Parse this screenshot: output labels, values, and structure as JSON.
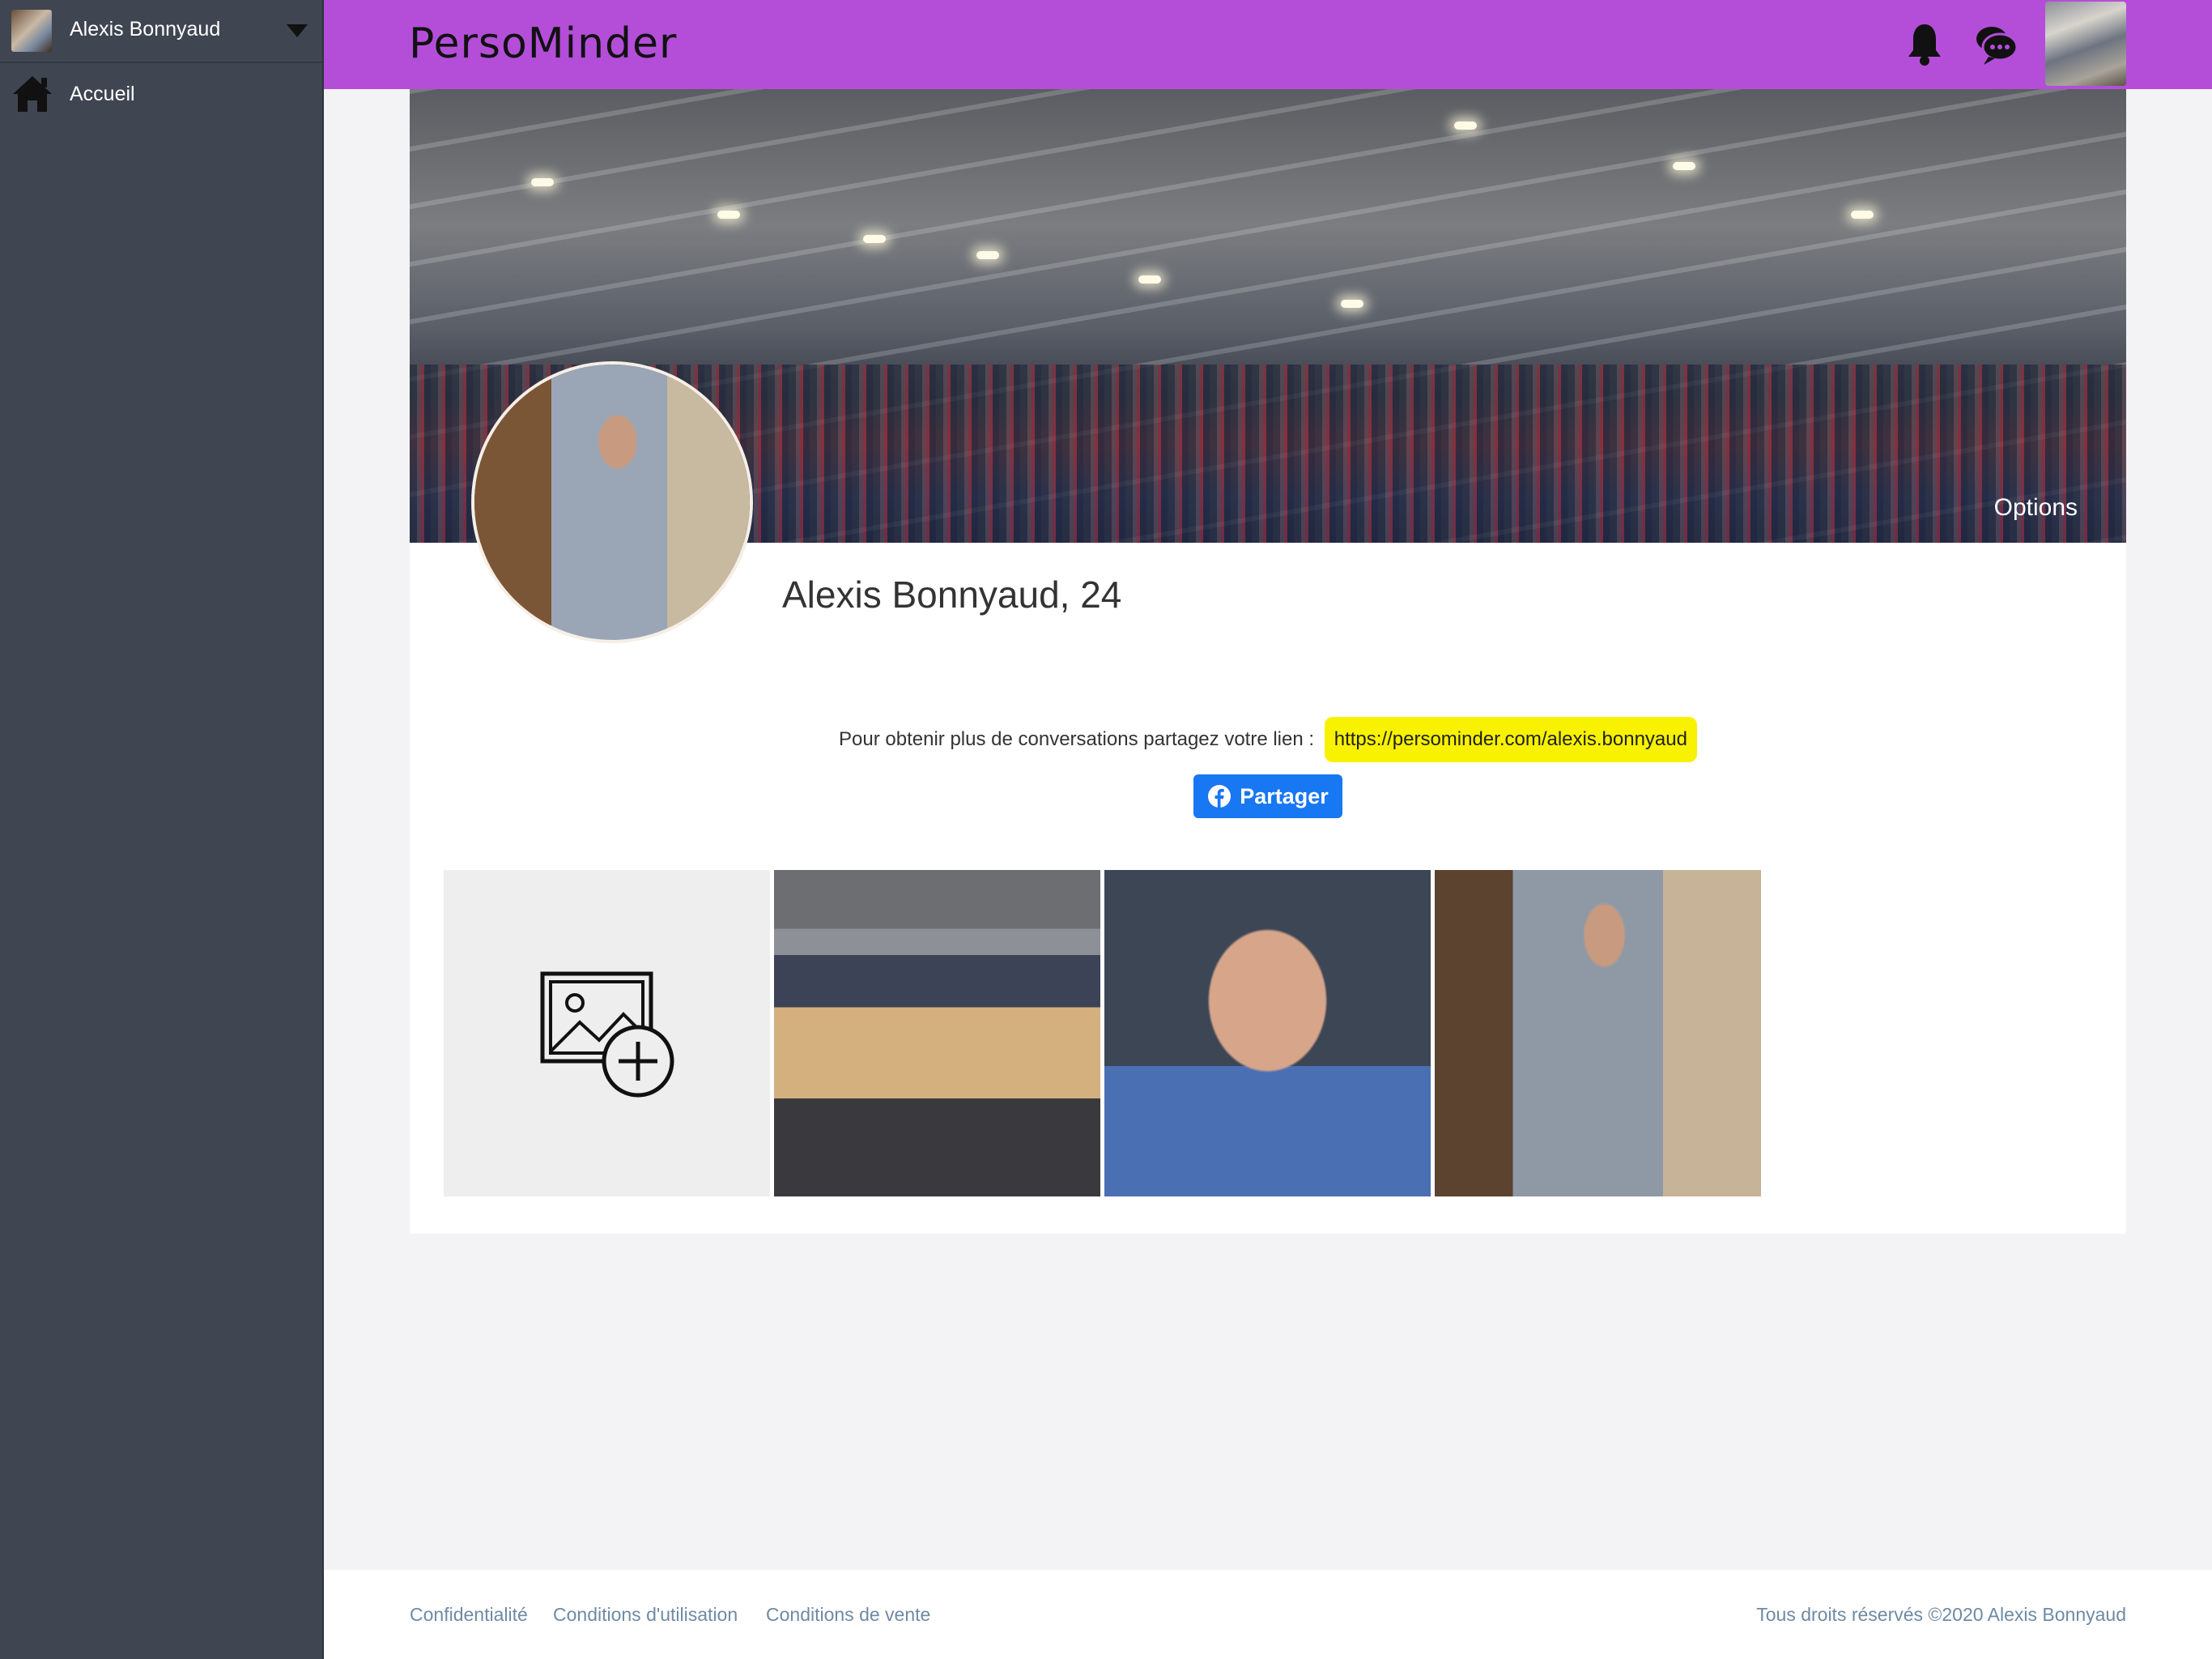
{
  "sidebar": {
    "user_name": "Alexis Bonnyaud",
    "home_label": "Accueil"
  },
  "header": {
    "logo": "PersoMinder"
  },
  "profile": {
    "cover_options_label": "Options",
    "name_age": "Alexis Bonnyaud, 24",
    "share_text": "Pour obtenir plus de conversations partagez votre lien :",
    "share_link": "https://persominder.com/alexis.bonnyaud",
    "share_button_label": "Partager"
  },
  "footer": {
    "links": [
      "Confidentialité",
      "Conditions d'utilisation",
      "Conditions de vente"
    ],
    "copyright": "Tous droits réservés ©2020 Alexis Bonnyaud"
  },
  "colors": {
    "header_bg": "#b44ed9",
    "sidebar_bg": "#3f4551",
    "share_link_bg": "#f8f200",
    "facebook_blue": "#1877f2",
    "footer_link": "#6f8aa3"
  },
  "icons": {
    "sidebar_caret": "caret-down-icon",
    "home": "home-icon",
    "notifications": "bell-icon",
    "messages": "chat-bubbles-icon",
    "share": "facebook-icon",
    "add_photo": "add-image-icon"
  }
}
